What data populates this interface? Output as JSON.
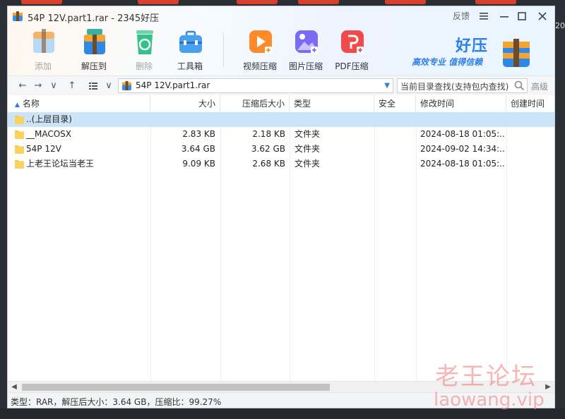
{
  "window": {
    "title": "54P 12V.part1.rar - 2345好压",
    "feedback": "反馈"
  },
  "toolbar": {
    "items": [
      {
        "label": "添加",
        "icon": "add-archive-icon",
        "enabled": false
      },
      {
        "label": "解压到",
        "icon": "extract-to-icon",
        "enabled": true
      },
      {
        "label": "删除",
        "icon": "delete-icon",
        "enabled": false
      },
      {
        "label": "工具箱",
        "icon": "toolbox-icon",
        "enabled": true
      },
      {
        "label": "视频压缩",
        "icon": "video-compress-icon",
        "enabled": true
      },
      {
        "label": "图片压缩",
        "icon": "image-compress-icon",
        "enabled": true
      },
      {
        "label": "PDF压缩",
        "icon": "pdf-compress-icon",
        "enabled": true
      }
    ]
  },
  "brand": {
    "name": "好压",
    "slogan": "高效专业  值得信赖"
  },
  "addressbar": {
    "path": "54P 12V.part1.rar",
    "search_placeholder": "当前目录查找(支持包内查找)",
    "advanced": "高级"
  },
  "columns": [
    "名称",
    "大小",
    "压缩后大小",
    "类型",
    "安全",
    "修改时间",
    "创建时间"
  ],
  "files": [
    {
      "name": "..(上层目录)",
      "size": "",
      "packed": "",
      "type": "",
      "security": "",
      "modified": "",
      "created": "",
      "selected": true
    },
    {
      "name": "__MACOSX",
      "size": "2.83 KB",
      "packed": "2.18 KB",
      "type": "文件夹",
      "security": "",
      "modified": "2024-08-18 01:05:...",
      "created": "",
      "selected": false
    },
    {
      "name": "54P 12V",
      "size": "3.64 GB",
      "packed": "3.62 GB",
      "type": "文件夹",
      "security": "",
      "modified": "2024-09-02 14:34:...",
      "created": "",
      "selected": false
    },
    {
      "name": "上老王论坛当老王",
      "size": "9.09 KB",
      "packed": "2.68 KB",
      "type": "文件夹",
      "security": "",
      "modified": "2024-08-18 01:05:...",
      "created": "",
      "selected": false
    }
  ],
  "status": {
    "text": "类型：RAR，解压后大小：3.64 GB，压缩比：99.27%"
  },
  "watermark": {
    "cn": "老王论坛",
    "en": "laowang.vip"
  },
  "background": {
    "right_text": "20"
  },
  "colors": {
    "accent": "#2f7fe8",
    "selection": "#cce4f7",
    "folder": "#f6c94a"
  }
}
